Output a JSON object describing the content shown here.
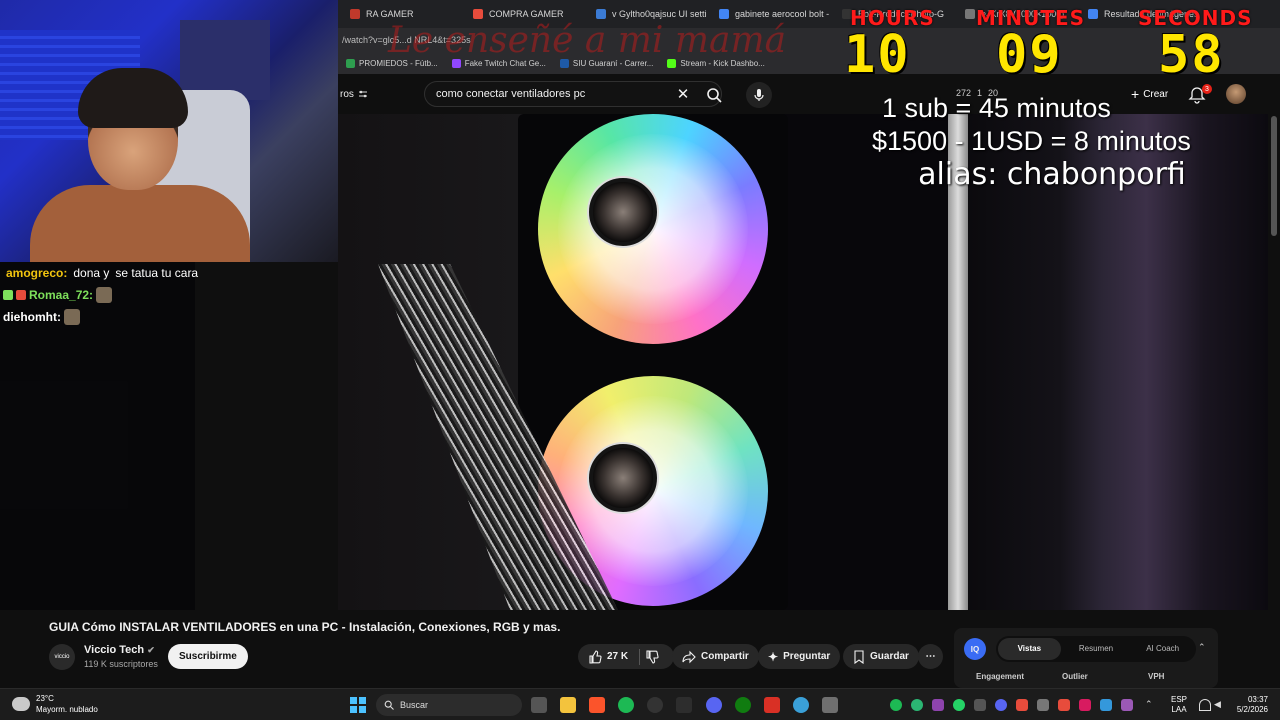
{
  "browser": {
    "tabs": [
      {
        "label": "RA GAMER",
        "color": "#c0392b"
      },
      {
        "label": "COMPRA GAMER",
        "color": "#e74c3c"
      },
      {
        "label": "v Gyltho0qajsuc UI settin",
        "color": "#3b7bd4"
      },
      {
        "label": "gabinete aerocool bolt -",
        "color": "#4285f4"
      },
      {
        "label": "Bolt-Product-Photo-G",
        "color": "#333333"
      },
      {
        "label": "eJKrX8 (1000×1000)",
        "color": "#777777"
      },
      {
        "label": "Resultado de imágenes",
        "color": "#4285f4"
      }
    ],
    "address": "/watch?v=glc5...d NRL4&t=325s",
    "bookmarks": [
      {
        "label": "PROMIEDOS - Fútb...",
        "color": "#2e9e4f"
      },
      {
        "label": "Fake Twitch Chat Ge...",
        "color": "#9147ff"
      },
      {
        "label": "SIU Guaraní - Carrer...",
        "color": "#1e5aa8"
      },
      {
        "label": "Stream - Kick Dashbo...",
        "color": "#53fc18"
      }
    ]
  },
  "youtube": {
    "filter_label": "ros",
    "search": {
      "value": "como conectar ventiladores pc"
    },
    "header_stats": [
      "272",
      "1",
      "20"
    ],
    "create_label": "Crear",
    "notif_count": "3"
  },
  "overlay": {
    "banner": "Le enseñé a mi mamá",
    "timer": {
      "labels": {
        "hours": "HOURS",
        "minutes": "MINUTES",
        "seconds": "SECONDS"
      },
      "hours": "10",
      "minutes": "09",
      "seconds": "58"
    },
    "rules": [
      "1 sub = 45 minutos",
      "$1500 - 1USD = 8 minutos",
      "alias: chabonporfi"
    ]
  },
  "chat": [
    {
      "user": "amogreco:",
      "message": "dona y",
      "extra": "se tatua tu cara",
      "color": "#f1c40f"
    },
    {
      "user": "Romaa_72:",
      "message": "",
      "extra": "",
      "color": "#7ee05b"
    },
    {
      "user": "diehomht:",
      "message": "",
      "extra": "",
      "color": "#ffffff"
    }
  ],
  "video": {
    "title": "GUIA Cómo INSTALAR VENTILADORES en una PC - Instalación, Conexiones, RGB y mas.",
    "channel": {
      "name": "Viccio Tech",
      "subs": "119 K suscriptores",
      "avatar_text": "viccio"
    },
    "subscribe_label": "Suscribirme",
    "likes": "27 K",
    "share_label": "Compartir",
    "ask_label": "Preguntar",
    "save_label": "Guardar"
  },
  "side_panel": {
    "logo": "IQ",
    "tabs": [
      "Vistas",
      "Resumen",
      "AI Coach"
    ],
    "columns": [
      "Engagement",
      "Outlier",
      "VPH"
    ]
  },
  "taskbar": {
    "weather": {
      "temp": "23°C",
      "desc": "Mayorm. nublado"
    },
    "search_label": "Buscar",
    "lang": [
      "ESP",
      "LAA"
    ],
    "time": "03:37",
    "date": "5/2/2026"
  },
  "colors": {
    "accent": "#ff0000",
    "timer_digits": "#ffe600",
    "timer_labels": "#ff1a1a"
  }
}
